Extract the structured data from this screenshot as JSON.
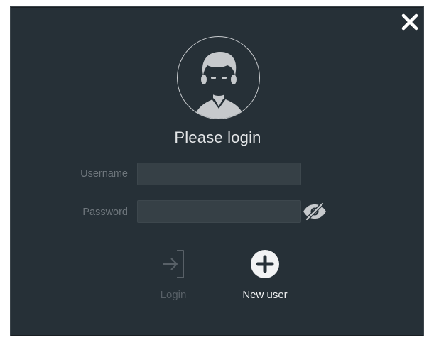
{
  "dialog": {
    "title": "Please login",
    "close_icon": "close-icon",
    "avatar_icon": "user-avatar-icon"
  },
  "form": {
    "username_label": "Username",
    "username_value": "",
    "password_label": "Password",
    "password_value": "",
    "password_toggle_icon": "eye-slash-icon"
  },
  "actions": {
    "login_label": "Login",
    "login_icon": "sign-in-icon",
    "new_user_label": "New user",
    "new_user_icon": "plus-circle-icon"
  },
  "colors": {
    "background": "#263037",
    "input_background": "#364046",
    "disabled_text": "#586067",
    "label_text": "#6e767c",
    "primary_text": "#e4e6e8"
  }
}
